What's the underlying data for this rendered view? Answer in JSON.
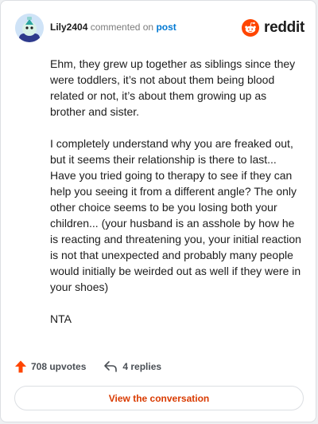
{
  "header": {
    "username": "Lily2404",
    "action_text": "commented on",
    "link_text": "post",
    "brand_name": "reddit"
  },
  "comment": {
    "paragraphs": [
      "Ehm, they grew up together as siblings since they were toddlers, it’s not about them being blood related or not, it’s about them growing up as brother and sister.",
      "I completely understand why you are freaked out, but it seems their relationship is there to last... Have you tried going to therapy to see if they can help you seeing it from a different angle? The only other choice seems to be you losing both your children... (your husband is an asshole by how he is reacting and threatening you, your initial reaction is not that unexpected and probably many people would initially be weirded out as well if they were in your shoes)",
      "NTA"
    ]
  },
  "stats": {
    "upvotes_label": "708 upvotes",
    "replies_label": "4 replies"
  },
  "cta": {
    "label": "View the conversation"
  },
  "colors": {
    "brand": "#ff4500",
    "link": "#0079d3",
    "cta_text": "#d93a00"
  },
  "icons": [
    "avatar",
    "reddit-logo-icon",
    "upvote-arrow-icon",
    "reply-arrow-icon"
  ]
}
